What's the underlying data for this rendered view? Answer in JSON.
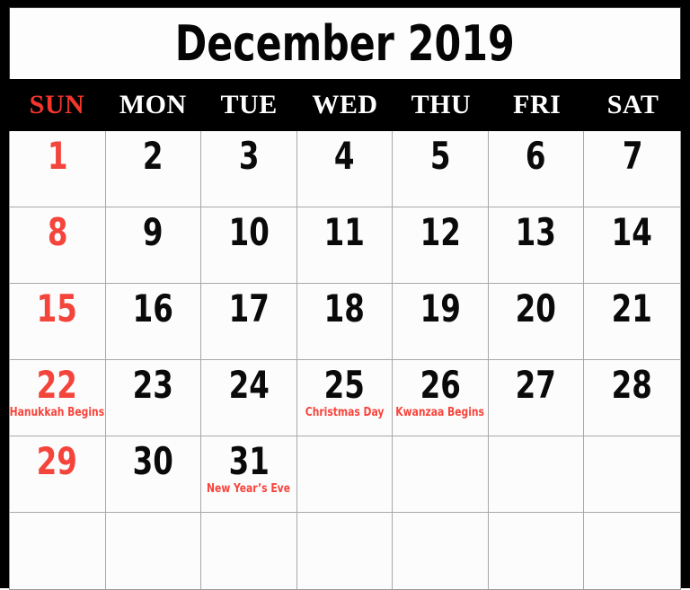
{
  "calendar": {
    "title": "December 2019",
    "month": "December",
    "year": "2019",
    "colors": {
      "frame": "#000000",
      "cell_background": "#fcfcfc",
      "header_background": "#000000",
      "accent_red": "#f4453c",
      "text_black": "#0a0a0a",
      "grid_line": "#a8a8a8"
    },
    "weekdays": [
      {
        "label": "SUN",
        "is_weekend": true
      },
      {
        "label": "MON",
        "is_weekend": false
      },
      {
        "label": "TUE",
        "is_weekend": false
      },
      {
        "label": "WED",
        "is_weekend": false
      },
      {
        "label": "THU",
        "is_weekend": false
      },
      {
        "label": "FRI",
        "is_weekend": false
      },
      {
        "label": "SAT",
        "is_weekend": false
      }
    ],
    "weeks": [
      [
        {
          "day": "1",
          "event": "",
          "sunday": true
        },
        {
          "day": "2",
          "event": "",
          "sunday": false
        },
        {
          "day": "3",
          "event": "",
          "sunday": false
        },
        {
          "day": "4",
          "event": "",
          "sunday": false
        },
        {
          "day": "5",
          "event": "",
          "sunday": false
        },
        {
          "day": "6",
          "event": "",
          "sunday": false
        },
        {
          "day": "7",
          "event": "",
          "sunday": false
        }
      ],
      [
        {
          "day": "8",
          "event": "",
          "sunday": true
        },
        {
          "day": "9",
          "event": "",
          "sunday": false
        },
        {
          "day": "10",
          "event": "",
          "sunday": false
        },
        {
          "day": "11",
          "event": "",
          "sunday": false
        },
        {
          "day": "12",
          "event": "",
          "sunday": false
        },
        {
          "day": "13",
          "event": "",
          "sunday": false
        },
        {
          "day": "14",
          "event": "",
          "sunday": false
        }
      ],
      [
        {
          "day": "15",
          "event": "",
          "sunday": true
        },
        {
          "day": "16",
          "event": "",
          "sunday": false
        },
        {
          "day": "17",
          "event": "",
          "sunday": false
        },
        {
          "day": "18",
          "event": "",
          "sunday": false
        },
        {
          "day": "19",
          "event": "",
          "sunday": false
        },
        {
          "day": "20",
          "event": "",
          "sunday": false
        },
        {
          "day": "21",
          "event": "",
          "sunday": false
        }
      ],
      [
        {
          "day": "22",
          "event": "Hanukkah Begins",
          "sunday": true
        },
        {
          "day": "23",
          "event": "",
          "sunday": false
        },
        {
          "day": "24",
          "event": "",
          "sunday": false
        },
        {
          "day": "25",
          "event": "Christmas Day",
          "sunday": false
        },
        {
          "day": "26",
          "event": "Kwanzaa Begins",
          "sunday": false
        },
        {
          "day": "27",
          "event": "",
          "sunday": false
        },
        {
          "day": "28",
          "event": "",
          "sunday": false
        }
      ],
      [
        {
          "day": "29",
          "event": "",
          "sunday": true
        },
        {
          "day": "30",
          "event": "",
          "sunday": false
        },
        {
          "day": "31",
          "event": "New Year’s Eve",
          "sunday": false
        },
        {
          "day": "",
          "event": "",
          "sunday": false
        },
        {
          "day": "",
          "event": "",
          "sunday": false
        },
        {
          "day": "",
          "event": "",
          "sunday": false
        },
        {
          "day": "",
          "event": "",
          "sunday": false
        }
      ],
      [
        {
          "day": "",
          "event": "",
          "sunday": true
        },
        {
          "day": "",
          "event": "",
          "sunday": false
        },
        {
          "day": "",
          "event": "",
          "sunday": false
        },
        {
          "day": "",
          "event": "",
          "sunday": false
        },
        {
          "day": "",
          "event": "",
          "sunday": false
        },
        {
          "day": "",
          "event": "",
          "sunday": false
        },
        {
          "day": "",
          "event": "",
          "sunday": false
        }
      ]
    ]
  }
}
